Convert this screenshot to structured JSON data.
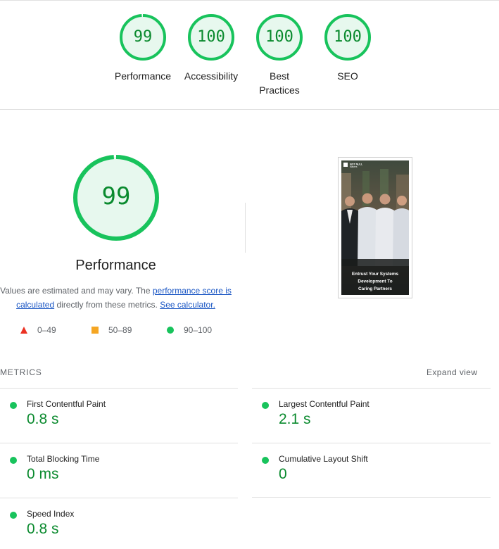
{
  "summary": {
    "gauges": [
      {
        "score": "99",
        "label": "Performance",
        "fraction": 0.99
      },
      {
        "score": "100",
        "label": "Accessibility",
        "fraction": 1.0
      },
      {
        "score": "100",
        "label": "Best Practices",
        "fraction": 1.0
      },
      {
        "score": "100",
        "label": "SEO",
        "fraction": 1.0
      }
    ]
  },
  "performance": {
    "score": "99",
    "fraction": 0.99,
    "title": "Performance",
    "desc_prefix": "Values are estimated and may vary. The ",
    "desc_link": "performance score is calculated",
    "desc_middle": " directly from these metrics. ",
    "calculator_link": "See calculator."
  },
  "legend": {
    "fail": "0–49",
    "average": "50–89",
    "pass": "90–100"
  },
  "thumbnail": {
    "logo_line1": "NOT NULL",
    "logo_line2": "Makers",
    "caption_line1": "Entrust Your Systems",
    "caption_line2": "Development To",
    "caption_line3": "Caring Partners"
  },
  "metrics": {
    "header": "METRICS",
    "expand_label": "Expand view",
    "items": [
      {
        "name": "First Contentful Paint",
        "value": "0.8 s"
      },
      {
        "name": "Largest Contentful Paint",
        "value": "2.1 s"
      },
      {
        "name": "Total Blocking Time",
        "value": "0 ms"
      },
      {
        "name": "Cumulative Layout Shift",
        "value": "0"
      },
      {
        "name": "Speed Index",
        "value": "0.8 s"
      }
    ]
  },
  "colors": {
    "pass": "#18c35c",
    "pass_text": "#0a8a2e",
    "pass_bg": "#e7f8ee",
    "average": "#f5a623",
    "fail": "#eb3223",
    "link": "#1a56c4"
  }
}
